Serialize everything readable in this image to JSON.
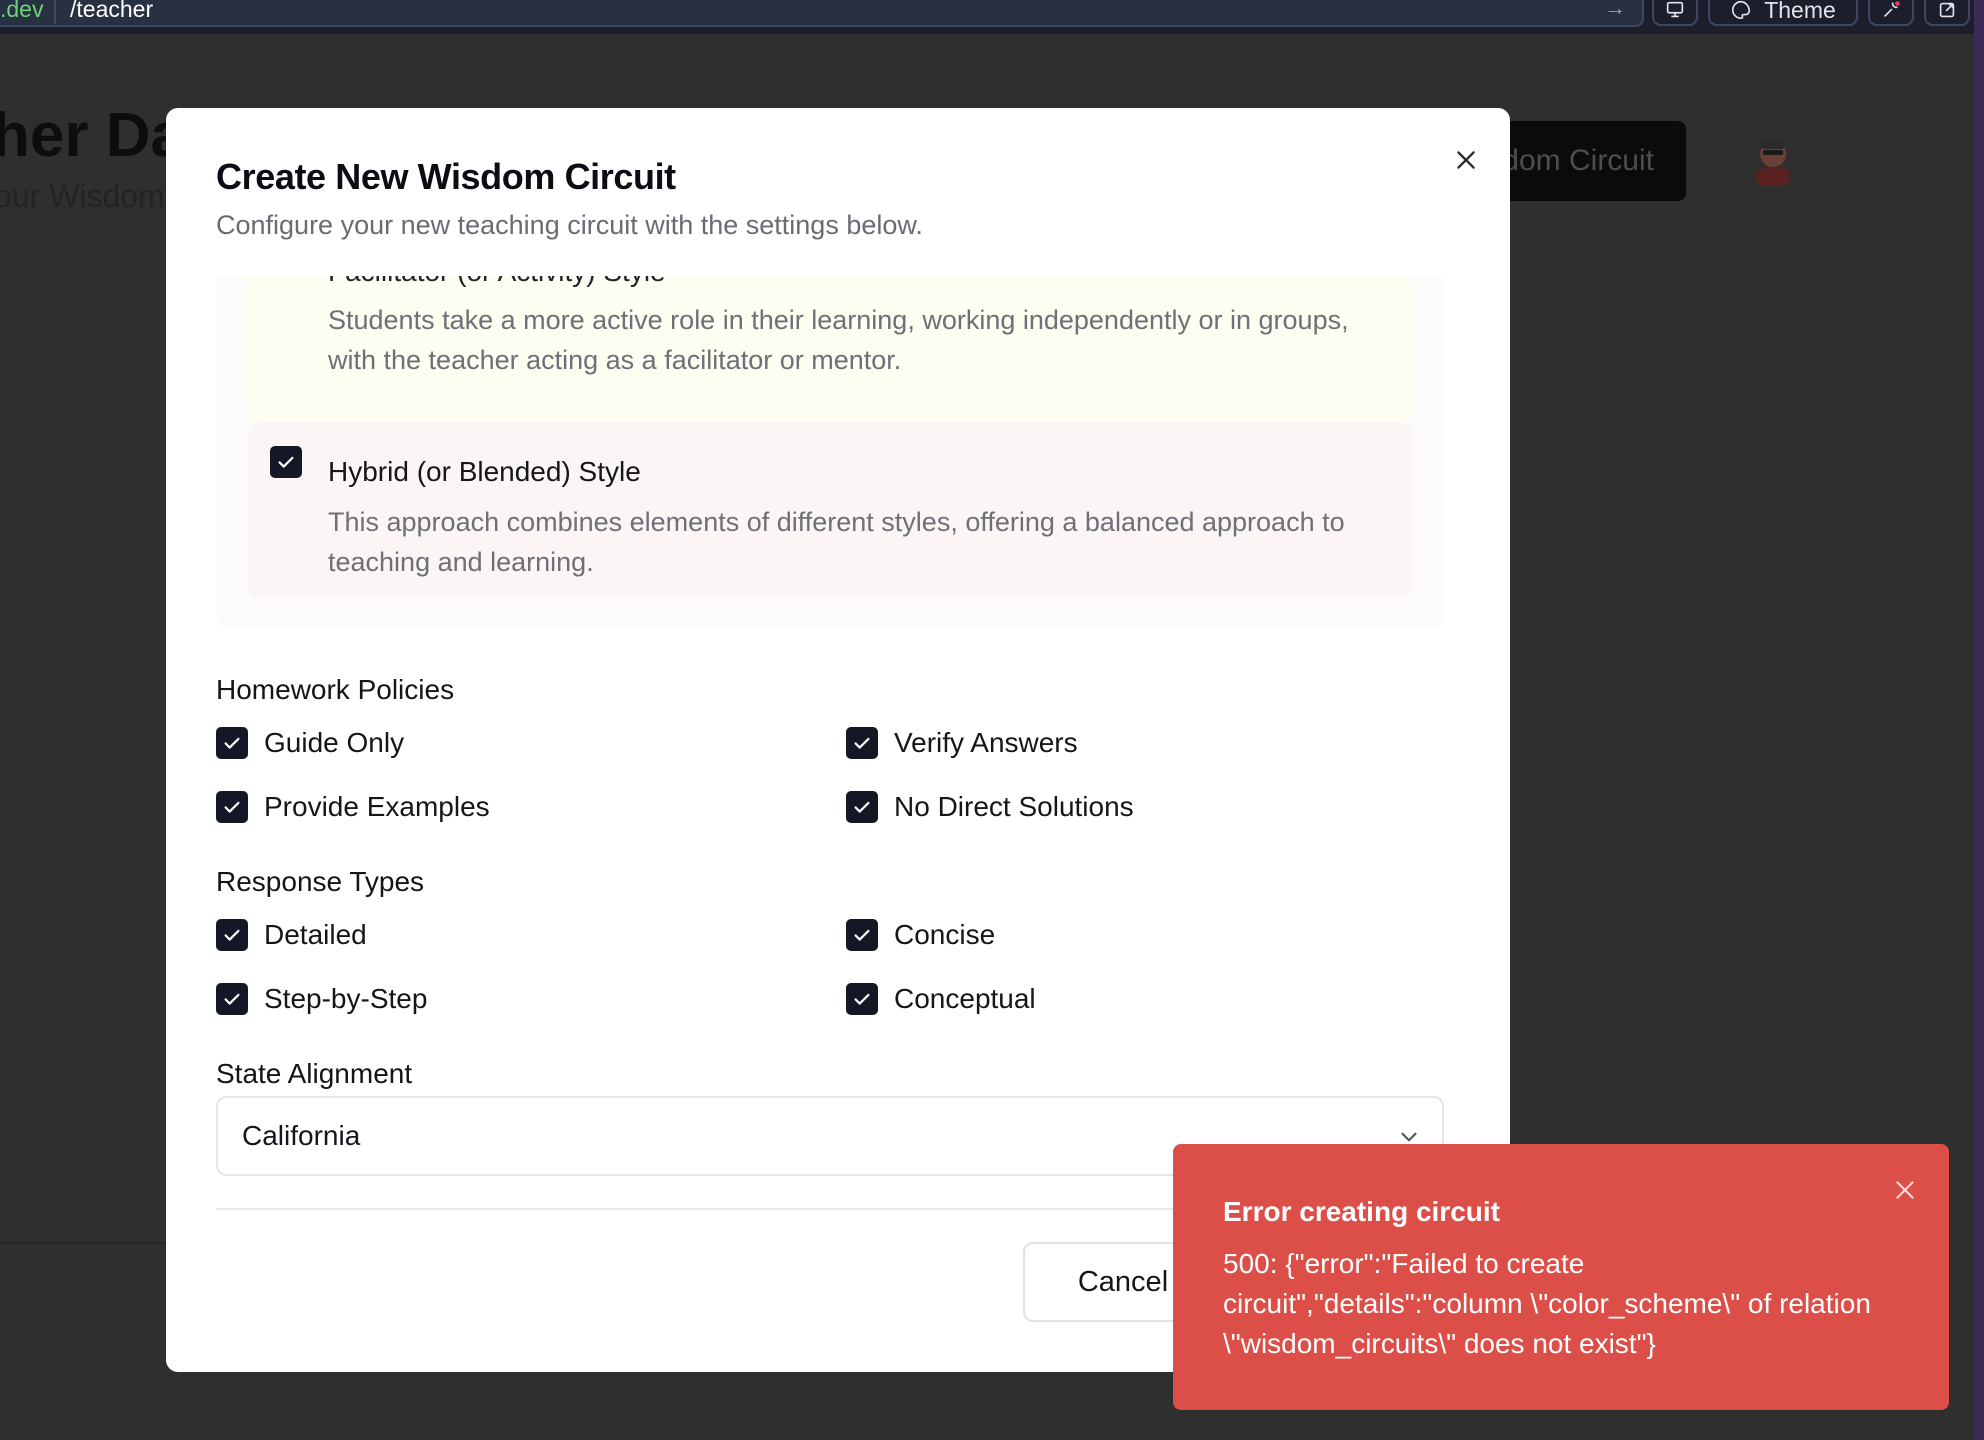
{
  "browser": {
    "domain_fragment": ".dev",
    "path": "/teacher",
    "theme_label": "Theme"
  },
  "background": {
    "title_fragment": "her Das",
    "subtitle_fragment": "our Wisdom",
    "cta_fragment": "dom Circuit"
  },
  "modal": {
    "title": "Create New Wisdom Circuit",
    "description": "Configure your new teaching circuit with the settings below.",
    "style_cards": [
      {
        "title_fragment": "Facilitator (or Activity) Style",
        "description": "Students take a more active role in their learning, working independently or in groups, with the teacher acting as a facilitator or mentor."
      },
      {
        "title": "Hybrid (or Blended) Style",
        "description": "This approach combines elements of different styles, offering a balanced approach to teaching and learning.",
        "checked": true
      }
    ],
    "homework_policies": {
      "label": "Homework Policies",
      "options": [
        {
          "label": "Guide Only",
          "checked": true
        },
        {
          "label": "Verify Answers",
          "checked": true
        },
        {
          "label": "Provide Examples",
          "checked": true
        },
        {
          "label": "No Direct Solutions",
          "checked": true
        }
      ]
    },
    "response_types": {
      "label": "Response Types",
      "options": [
        {
          "label": "Detailed",
          "checked": true
        },
        {
          "label": "Concise",
          "checked": true
        },
        {
          "label": "Step-by-Step",
          "checked": true
        },
        {
          "label": "Conceptual",
          "checked": true
        }
      ]
    },
    "state_alignment": {
      "label": "State Alignment",
      "value": "California"
    },
    "cancel_label": "Cancel"
  },
  "toast": {
    "title": "Error creating circuit",
    "message": "500: {\"error\":\"Failed to create circuit\",\"details\":\"column \\\"color_scheme\\\" of relation \\\"wisdom_circuits\\\" does not exist\"}",
    "color": "#dc4e48"
  },
  "colors": {
    "checkbox": "#131726",
    "overlay": "#2f2f2f"
  }
}
